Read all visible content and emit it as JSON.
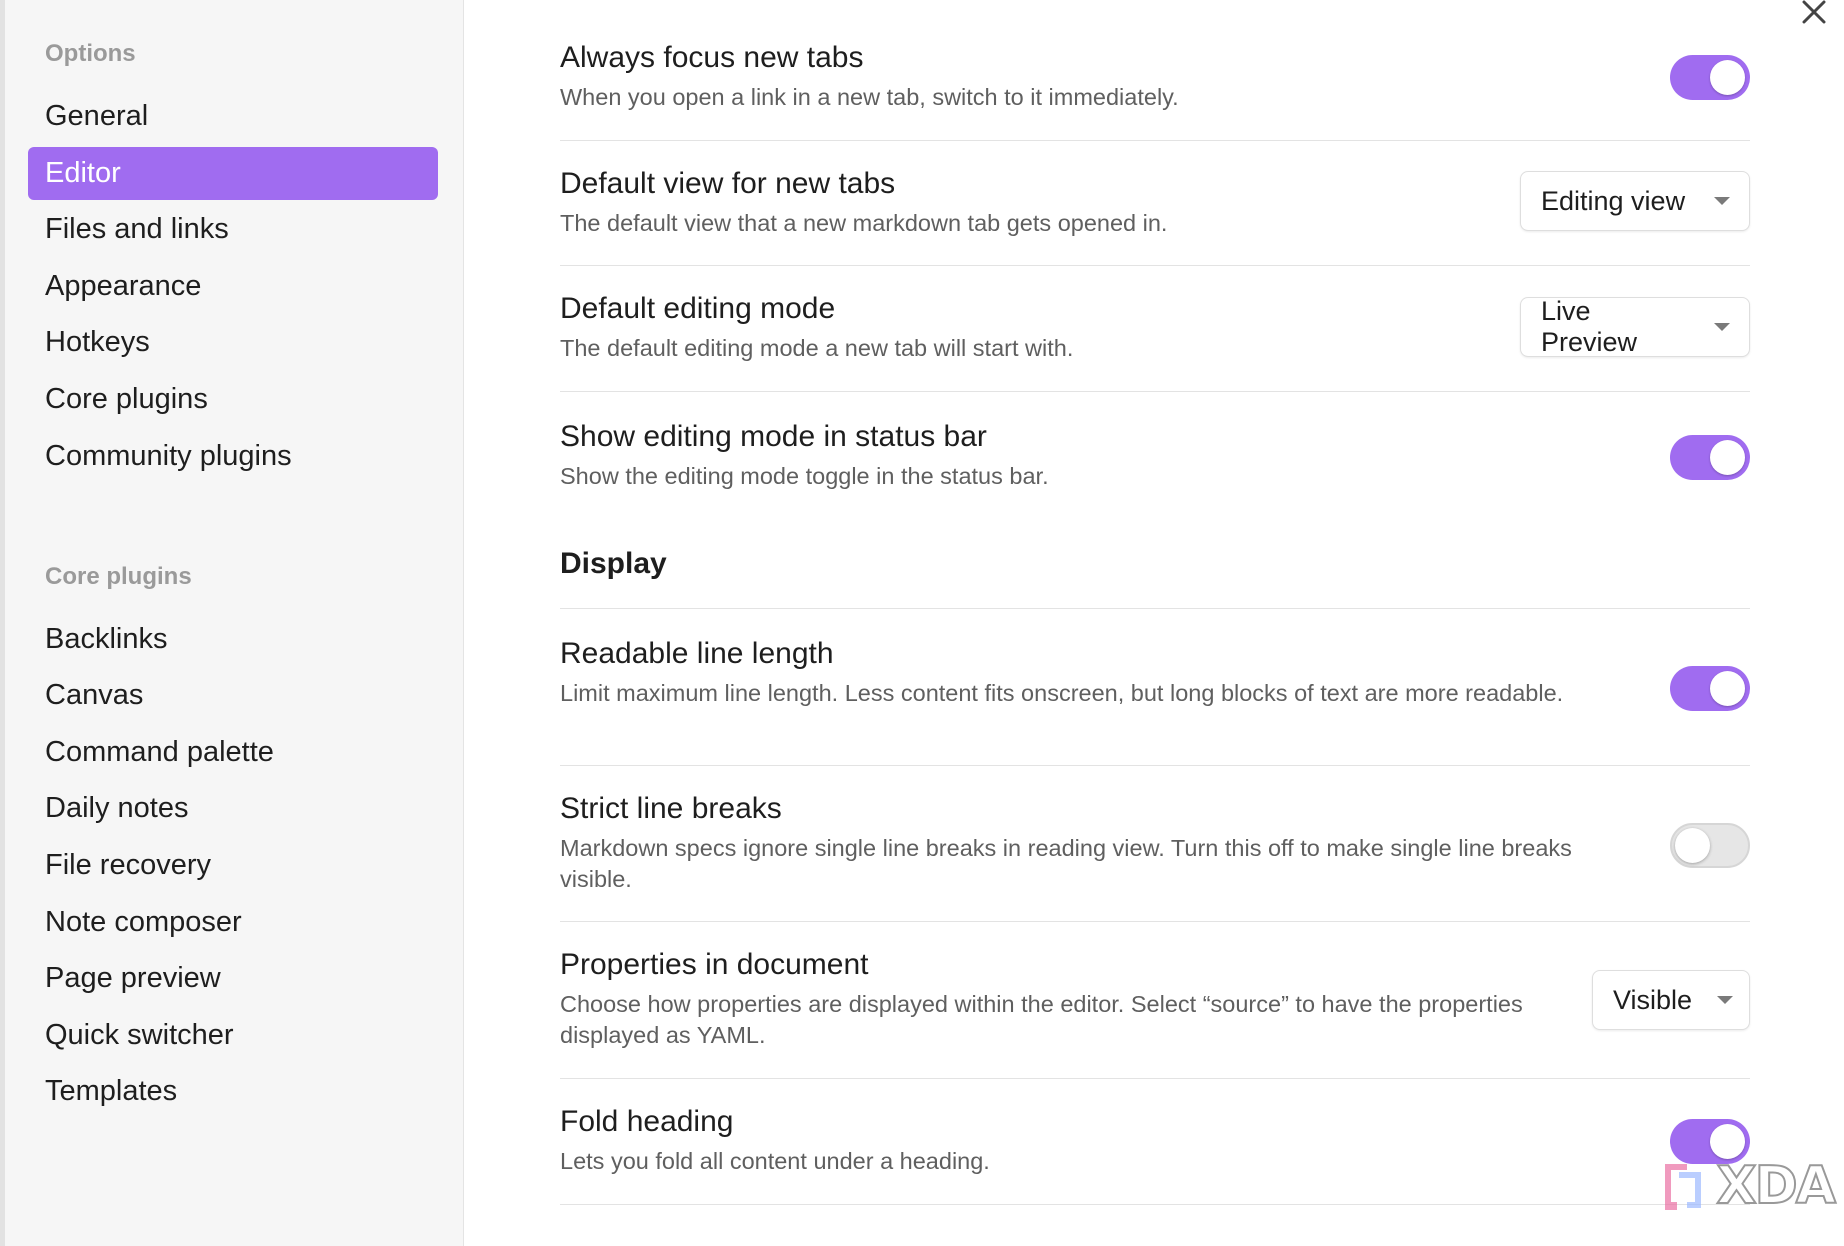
{
  "sidebar": {
    "options_heading": "Options",
    "options_items": [
      {
        "label": "General"
      },
      {
        "label": "Editor",
        "active": true
      },
      {
        "label": "Files and links"
      },
      {
        "label": "Appearance"
      },
      {
        "label": "Hotkeys"
      },
      {
        "label": "Core plugins"
      },
      {
        "label": "Community plugins"
      }
    ],
    "core_plugins_heading": "Core plugins",
    "core_plugins_items": [
      {
        "label": "Backlinks"
      },
      {
        "label": "Canvas"
      },
      {
        "label": "Command palette"
      },
      {
        "label": "Daily notes"
      },
      {
        "label": "File recovery"
      },
      {
        "label": "Note composer"
      },
      {
        "label": "Page preview"
      },
      {
        "label": "Quick switcher"
      },
      {
        "label": "Templates"
      }
    ]
  },
  "settings": {
    "always_focus": {
      "name": "Always focus new tabs",
      "desc": "When you open a link in a new tab, switch to it immediately.",
      "enabled": true
    },
    "default_view": {
      "name": "Default view for new tabs",
      "desc": "The default view that a new markdown tab gets opened in.",
      "value": "Editing view"
    },
    "default_editing_mode": {
      "name": "Default editing mode",
      "desc": "The default editing mode a new tab will start with.",
      "value": "Live Preview"
    },
    "show_editing_mode": {
      "name": "Show editing mode in status bar",
      "desc": "Show the editing mode toggle in the status bar.",
      "enabled": true
    },
    "display_heading": "Display",
    "readable_line_length": {
      "name": "Readable line length",
      "desc": "Limit maximum line length. Less content fits onscreen, but long blocks of text are more readable.",
      "enabled": true
    },
    "strict_line_breaks": {
      "name": "Strict line breaks",
      "desc": "Markdown specs ignore single line breaks in reading view. Turn this off to make single line breaks visible.",
      "enabled": false
    },
    "properties_in_document": {
      "name": "Properties in document",
      "desc": "Choose how properties are displayed within the editor. Select “source” to have the properties displayed as YAML.",
      "value": "Visible"
    },
    "fold_heading": {
      "name": "Fold heading",
      "desc": "Lets you fold all content under a heading.",
      "enabled": true
    }
  },
  "watermark": {
    "text": "XDA"
  },
  "colors": {
    "accent": "#a06cf0",
    "sidebar_bg": "#f6f6f6",
    "toggle_off": "#e6e6e6"
  },
  "icons": {
    "close": "close-icon",
    "dropdown": "chevron-down-icon",
    "watermark": "xda-logo-icon"
  }
}
